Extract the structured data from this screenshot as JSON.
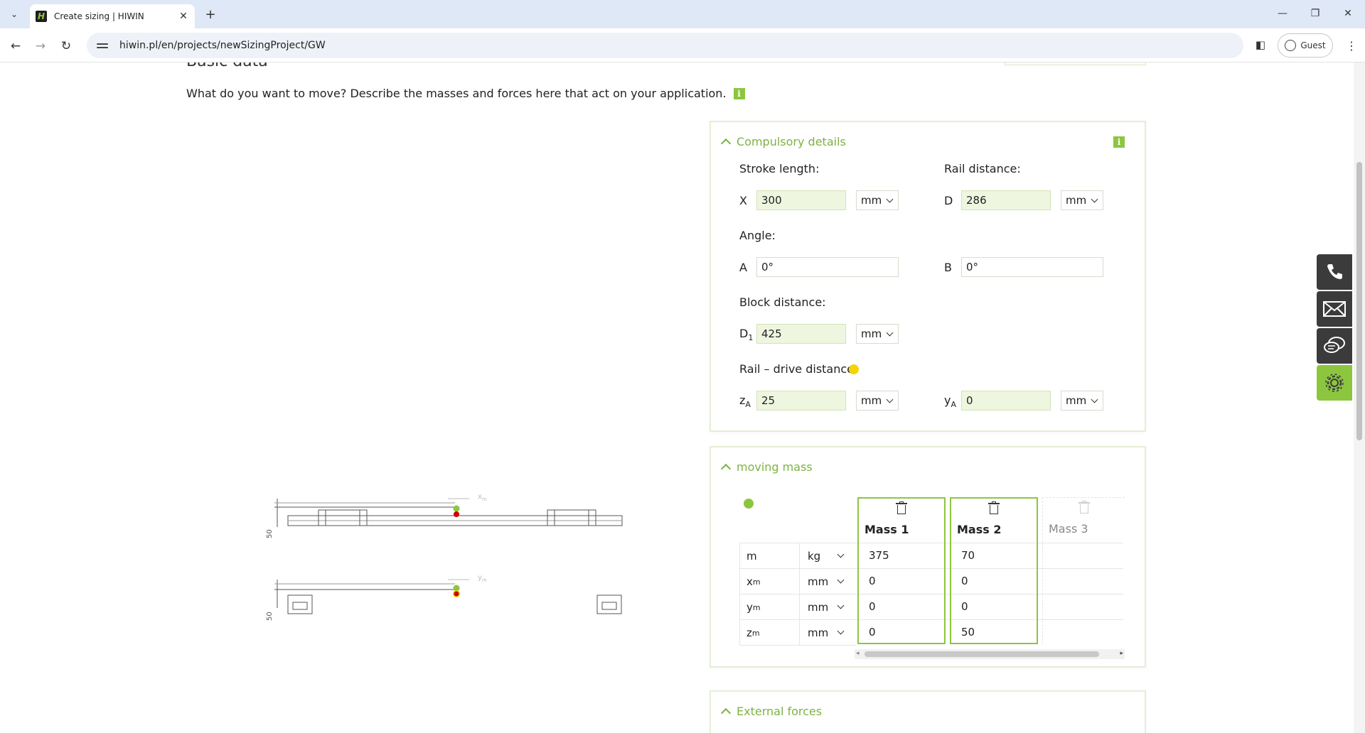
{
  "browser": {
    "tab_title": "Create sizing | HIWIN",
    "favicon_letter": "H",
    "url": "hiwin.pl/en/projects/newSizingProject/GW",
    "profile_label": "Guest",
    "accent_color": "#8cc63e"
  },
  "page": {
    "section_heading": "Basic data",
    "intro_text": "What do you want to move? Describe the masses and forces here that act on your application.",
    "info_icon": "i"
  },
  "compulsory": {
    "title": "Compulsory details",
    "stroke_label": "Stroke length:",
    "stroke_prefix": "X",
    "stroke_value": "300",
    "stroke_unit": "mm",
    "rail_label": "Rail distance:",
    "rail_prefix": "D",
    "rail_value": "286",
    "rail_unit": "mm",
    "angle_label": "Angle:",
    "angle_a_prefix": "A",
    "angle_a_value": "0°",
    "angle_b_prefix": "B",
    "angle_b_value": "0°",
    "block_label": "Block distance:",
    "block_prefix": "D",
    "block_prefix_sub": "1",
    "block_value": "425",
    "block_unit": "mm",
    "drive_label": "Rail – drive distance:",
    "za_prefix": "z",
    "za_prefix_sub": "A",
    "za_value": "25",
    "za_unit": "mm",
    "ya_prefix": "y",
    "ya_prefix_sub": "A",
    "ya_value": "0",
    "ya_unit": "mm"
  },
  "moving_mass": {
    "title": "moving mass",
    "masses": [
      "Mass 1",
      "Mass 2",
      "Mass 3"
    ],
    "rows": [
      {
        "sym": "m",
        "sub": "",
        "unit": "kg",
        "values": [
          "375",
          "70"
        ]
      },
      {
        "sym": "x",
        "sub": "m",
        "unit": "mm",
        "values": [
          "0",
          "0"
        ]
      },
      {
        "sym": "y",
        "sub": "m",
        "unit": "mm",
        "values": [
          "0",
          "0"
        ]
      },
      {
        "sym": "z",
        "sub": "m",
        "unit": "mm",
        "values": [
          "0",
          "50"
        ]
      }
    ]
  },
  "external_forces": {
    "title": "External forces"
  },
  "drawing": {
    "xm_label": "x",
    "xm_sub": "m",
    "ym_label": "y",
    "ym_sub": "m",
    "dim_top": "50",
    "dim_bottom": "50"
  }
}
